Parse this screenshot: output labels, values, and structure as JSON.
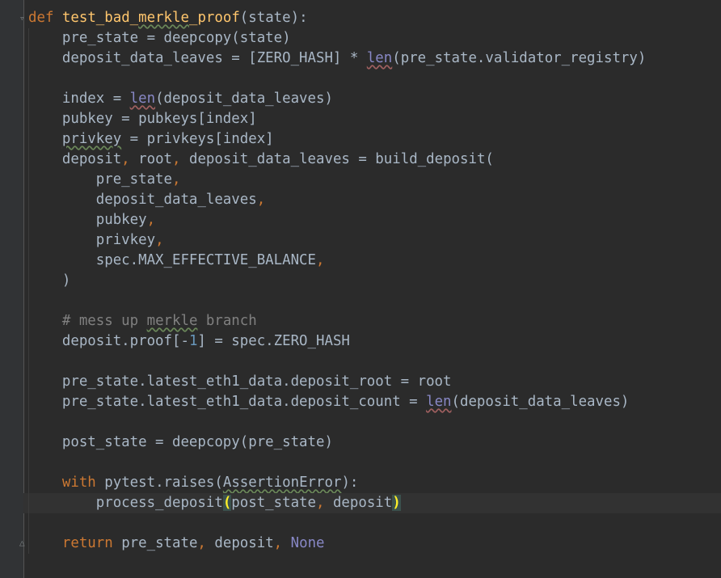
{
  "editor": {
    "language": "python",
    "colors": {
      "background": "#2b2b2b",
      "keyword": "#cc7832",
      "function_def": "#ffc66d",
      "builtin": "#8888c6",
      "number": "#6897bb",
      "comment": "#808080",
      "text": "#a9b7c6",
      "bracket_match": "#ffef28"
    },
    "lines": [
      {
        "tokens": [
          {
            "t": "def",
            "c": "kw"
          },
          {
            "t": " ",
            "c": "txt"
          },
          {
            "t": "test_bad_",
            "c": "fn"
          },
          {
            "t": "merkle",
            "c": "fn typo"
          },
          {
            "t": "_proof",
            "c": "fn"
          },
          {
            "t": "(state):",
            "c": "txt"
          }
        ]
      },
      {
        "tokens": [
          {
            "t": "    pre_state = deepcopy(state)",
            "c": "txt"
          }
        ]
      },
      {
        "tokens": [
          {
            "t": "    deposit_data_leaves = [ZERO_HASH] * ",
            "c": "txt"
          },
          {
            "t": "len",
            "c": "bi warn"
          },
          {
            "t": "(pre_state.validator_registry)",
            "c": "txt"
          }
        ]
      },
      {
        "tokens": []
      },
      {
        "tokens": [
          {
            "t": "    index = ",
            "c": "txt"
          },
          {
            "t": "len",
            "c": "bi warn"
          },
          {
            "t": "(deposit_data_leaves)",
            "c": "txt"
          }
        ]
      },
      {
        "tokens": [
          {
            "t": "    pubkey = pubkeys[index]",
            "c": "txt"
          }
        ]
      },
      {
        "tokens": [
          {
            "t": "    ",
            "c": "txt"
          },
          {
            "t": "privkey",
            "c": "txt typo"
          },
          {
            "t": " = privkeys[index]",
            "c": "txt"
          }
        ]
      },
      {
        "tokens": [
          {
            "t": "    deposit",
            "c": "txt"
          },
          {
            "t": ",",
            "c": "kw"
          },
          {
            "t": " root",
            "c": "txt"
          },
          {
            "t": ",",
            "c": "kw"
          },
          {
            "t": " deposit_data_leaves = build_deposit(",
            "c": "txt"
          }
        ]
      },
      {
        "tokens": [
          {
            "t": "        pre_state",
            "c": "txt"
          },
          {
            "t": ",",
            "c": "kw"
          }
        ]
      },
      {
        "tokens": [
          {
            "t": "        deposit_data_leaves",
            "c": "txt"
          },
          {
            "t": ",",
            "c": "kw"
          }
        ]
      },
      {
        "tokens": [
          {
            "t": "        pubkey",
            "c": "txt"
          },
          {
            "t": ",",
            "c": "kw"
          }
        ]
      },
      {
        "tokens": [
          {
            "t": "        privkey",
            "c": "txt"
          },
          {
            "t": ",",
            "c": "kw"
          }
        ]
      },
      {
        "tokens": [
          {
            "t": "        spec.MAX_EFFECTIVE_BALANCE",
            "c": "txt"
          },
          {
            "t": ",",
            "c": "kw"
          }
        ]
      },
      {
        "tokens": [
          {
            "t": "    )",
            "c": "txt"
          }
        ]
      },
      {
        "tokens": []
      },
      {
        "tokens": [
          {
            "t": "    # mess up ",
            "c": "cmt"
          },
          {
            "t": "merkle",
            "c": "cmt typo"
          },
          {
            "t": " branch",
            "c": "cmt"
          }
        ]
      },
      {
        "tokens": [
          {
            "t": "    deposit.proof[-",
            "c": "txt"
          },
          {
            "t": "1",
            "c": "num"
          },
          {
            "t": "] = spec.ZERO_HASH",
            "c": "txt"
          }
        ]
      },
      {
        "tokens": []
      },
      {
        "tokens": [
          {
            "t": "    pre_state.latest_eth1_data.deposit_root = root",
            "c": "txt"
          }
        ]
      },
      {
        "tokens": [
          {
            "t": "    pre_state.latest_eth1_data.deposit_count = ",
            "c": "txt"
          },
          {
            "t": "len",
            "c": "bi warn"
          },
          {
            "t": "(deposit_data_leaves)",
            "c": "txt"
          }
        ]
      },
      {
        "tokens": []
      },
      {
        "tokens": [
          {
            "t": "    post_state = deepcopy(pre_state)",
            "c": "txt"
          }
        ]
      },
      {
        "tokens": []
      },
      {
        "tokens": [
          {
            "t": "    ",
            "c": "txt"
          },
          {
            "t": "with",
            "c": "kw"
          },
          {
            "t": " pytest.raises(",
            "c": "txt"
          },
          {
            "t": "AssertionError",
            "c": "txt typo"
          },
          {
            "t": "):",
            "c": "txt"
          }
        ]
      },
      {
        "current": true,
        "tokens": [
          {
            "t": "        process_deposit",
            "c": "txt"
          },
          {
            "t": "(",
            "c": "match"
          },
          {
            "t": "post_state",
            "c": "txt"
          },
          {
            "t": ",",
            "c": "kw"
          },
          {
            "t": " deposit",
            "c": "txt"
          },
          {
            "t": ")",
            "c": "match"
          }
        ]
      },
      {
        "tokens": []
      },
      {
        "tokens": [
          {
            "t": "    ",
            "c": "txt"
          },
          {
            "t": "return",
            "c": "kw"
          },
          {
            "t": " pre_state",
            "c": "txt"
          },
          {
            "t": ",",
            "c": "kw"
          },
          {
            "t": " deposit",
            "c": "txt"
          },
          {
            "t": ",",
            "c": "kw"
          },
          {
            "t": " ",
            "c": "txt"
          },
          {
            "t": "None",
            "c": "bi"
          }
        ]
      }
    ]
  }
}
